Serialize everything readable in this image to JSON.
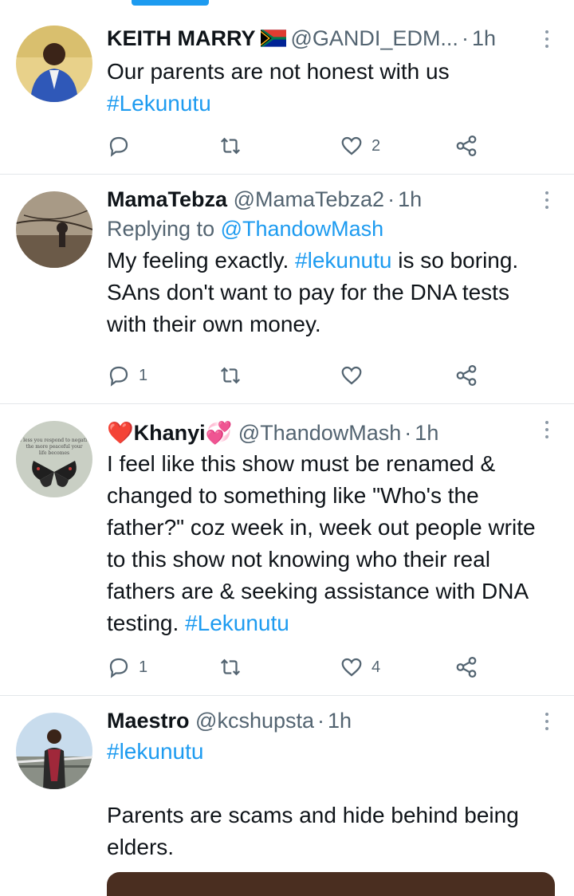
{
  "tweets": [
    {
      "name": "KEITH MARRY",
      "handle": "@GANDI_EDM...",
      "time": "1h",
      "flag": "south-africa-flag",
      "text_parts": [
        "Our parents are not honest with us",
        "#Lekunutu"
      ],
      "replies": "",
      "retweets": "",
      "likes": "2"
    },
    {
      "name": "MamaTebza",
      "handle": "@MamaTebza2",
      "time": "1h",
      "replying_label": "Replying to",
      "replying_to": "@ThandowMash",
      "text_parts": [
        "My feeling exactly. ",
        "#lekunutu",
        " is so boring. SAns don't want to pay for the DNA tests with their own money."
      ],
      "replies": "1",
      "retweets": "",
      "likes": ""
    },
    {
      "name": "❤️Khanyi💞",
      "handle": "@ThandowMash",
      "time": "1h",
      "text_parts": [
        "I feel like this show must be renamed & changed to something like \"Who's the father?\" coz week in, week out people write to this show not knowing who their real fathers are & seeking assistance with DNA testing. ",
        "#Lekunutu"
      ],
      "avatar_caption": "The less you respond to negativity the more peaceful your life becomes",
      "replies": "1",
      "retweets": "",
      "likes": "4"
    },
    {
      "name": "Maestro",
      "handle": "@kcshupsta",
      "time": "1h",
      "text_parts": [
        "#lekunutu",
        "Parents are scams and hide behind being elders."
      ]
    }
  ],
  "separator": "·",
  "colors": {
    "accent": "#1d9bf0",
    "muted": "#536471",
    "text": "#0f1419",
    "divider": "#e3e7ea"
  },
  "icons": [
    "reply-icon",
    "retweet-icon",
    "like-icon",
    "share-icon",
    "more-options-icon"
  ]
}
